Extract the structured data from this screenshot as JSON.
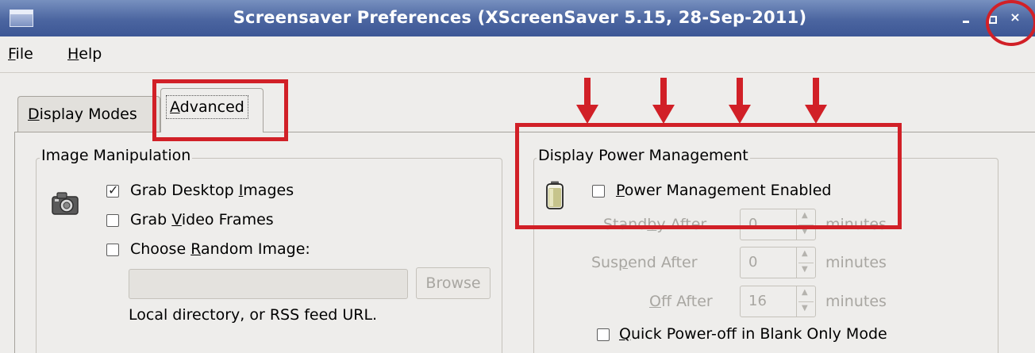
{
  "window": {
    "title": "Screensaver Preferences  (XScreenSaver 5.15, 28-Sep-2011)",
    "minimize": "_",
    "maximize": "",
    "close": "×"
  },
  "menubar": {
    "file": {
      "accel": "F",
      "rest": "ile"
    },
    "help": {
      "accel": "H",
      "rest": "elp"
    }
  },
  "tabs": [
    {
      "accel": "D",
      "rest": "isplay Modes",
      "selected": false
    },
    {
      "accel": "A",
      "rest": "dvanced",
      "selected": true
    }
  ],
  "image_manipulation": {
    "label": "Image Manipulation",
    "grab_desktop": {
      "pre": "Grab Desktop ",
      "accel": "I",
      "post": "mages",
      "checked": true
    },
    "grab_video": {
      "pre": "Grab ",
      "accel": "V",
      "post": "ideo Frames",
      "checked": false
    },
    "choose_random": {
      "pre": "Choose ",
      "accel": "R",
      "post": "andom Image:",
      "checked": false
    },
    "path_value": "",
    "browse_label": "Browse",
    "hint": "Local directory, or RSS feed URL."
  },
  "display_power": {
    "label": "Display Power Management",
    "enabled": {
      "pre": "",
      "accel": "P",
      "post": "ower Management Enabled",
      "checked": false
    },
    "standby": {
      "pre": "Stand",
      "accel": "b",
      "post": "y After",
      "value": "0",
      "unit": "minutes"
    },
    "suspend": {
      "pre": "Sus",
      "accel": "p",
      "post": "end After",
      "value": "0",
      "unit": "minutes"
    },
    "off": {
      "pre": "",
      "accel": "O",
      "post": "ff After",
      "value": "16",
      "unit": "minutes"
    },
    "quick_off": {
      "pre": "",
      "accel": "Q",
      "post": "uick Power-off in Blank Only Mode",
      "checked": false
    }
  },
  "annotation_color": "#d12027"
}
